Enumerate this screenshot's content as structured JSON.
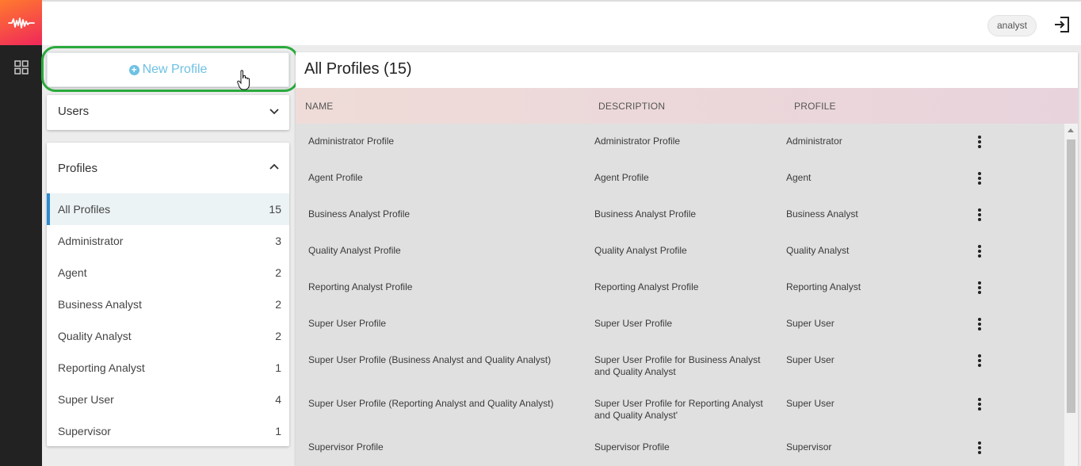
{
  "topbar": {
    "user": "analyst"
  },
  "sidebar": {
    "new_profile_label": "New Profile",
    "users_title": "Users",
    "profiles_title": "Profiles",
    "profiles": [
      {
        "label": "All Profiles",
        "count": "15"
      },
      {
        "label": "Administrator",
        "count": "3"
      },
      {
        "label": "Agent",
        "count": "2"
      },
      {
        "label": "Business Analyst",
        "count": "2"
      },
      {
        "label": "Quality Analyst",
        "count": "2"
      },
      {
        "label": "Reporting Analyst",
        "count": "1"
      },
      {
        "label": "Super User",
        "count": "4"
      },
      {
        "label": "Supervisor",
        "count": "1"
      }
    ]
  },
  "main": {
    "title": "All Profiles (15)",
    "columns": {
      "name": "NAME",
      "description": "DESCRIPTION",
      "profile": "PROFILE"
    },
    "rows": [
      {
        "name": "Administrator Profile",
        "description": "Administrator Profile",
        "profile": "Administrator"
      },
      {
        "name": "Agent Profile",
        "description": "Agent Profile",
        "profile": "Agent"
      },
      {
        "name": "Business Analyst Profile",
        "description": "Business Analyst Profile",
        "profile": "Business Analyst"
      },
      {
        "name": "Quality Analyst Profile",
        "description": "Quality Analyst Profile",
        "profile": "Quality Analyst"
      },
      {
        "name": "Reporting Analyst Profile",
        "description": "Reporting Analyst Profile",
        "profile": "Reporting Analyst"
      },
      {
        "name": "Super User Profile",
        "description": "Super User Profile",
        "profile": "Super User"
      },
      {
        "name": "Super User Profile (Business Analyst and Quality Analyst)",
        "description": "Super User Profile for Business Analyst and Quality Analyst",
        "profile": "Super User"
      },
      {
        "name": "Super User Profile (Reporting Analyst and Quality Analyst)",
        "description": "Super User Profile for Reporting Analyst and Quality Analyst'",
        "profile": "Super User"
      },
      {
        "name": "Supervisor Profile",
        "description": "Supervisor Profile",
        "profile": "Supervisor"
      }
    ]
  },
  "colors": {
    "accent": "#6ec1e4",
    "active_bar": "#2b8bd0",
    "highlight": "#2aaa3c"
  }
}
